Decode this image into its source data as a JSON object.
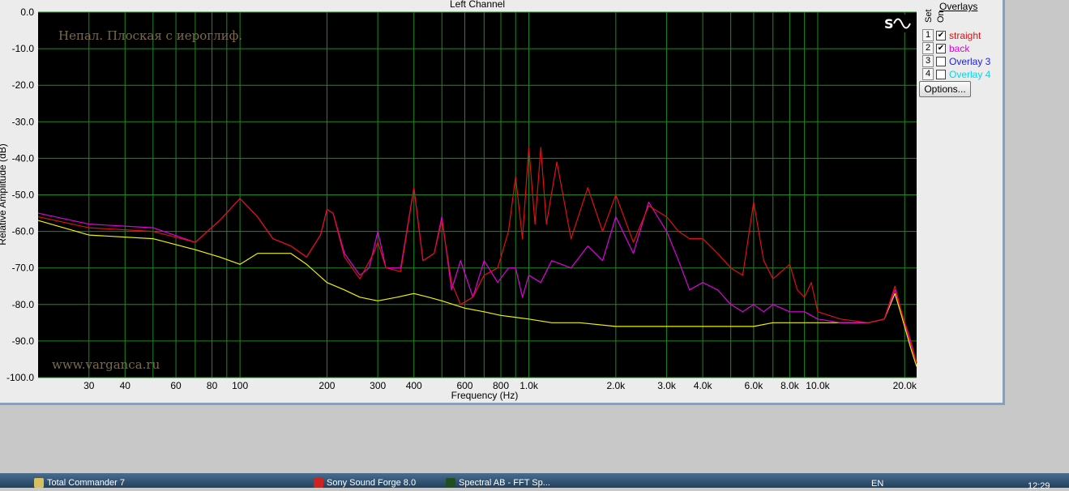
{
  "window": {
    "title": "Left Channel"
  },
  "overlays": {
    "title": "Overlays",
    "col_set": "Set",
    "col_on": "On",
    "items": [
      {
        "num": "1",
        "label": "straight",
        "checked": true,
        "color": "#e01010"
      },
      {
        "num": "2",
        "label": "back",
        "checked": true,
        "color": "#e000e0"
      },
      {
        "num": "3",
        "label": "Overlay 3",
        "checked": false,
        "color": "#2020e0"
      },
      {
        "num": "4",
        "label": "Overlay 4",
        "checked": false,
        "color": "#00d8e8"
      }
    ],
    "options_label": "Options..."
  },
  "icon": "sweep-sine-icon",
  "taskbar": {
    "items": [
      "Total Commander 7",
      "Sony Sound Forge 8.0",
      "Spectral AB - FFT Sp..."
    ],
    "lang": "EN",
    "clock": "12:29"
  },
  "chart_data": {
    "type": "line",
    "title": "Left Channel",
    "xlabel": "Frequency (Hz)",
    "ylabel": "Relative Amplitude (dB)",
    "x_scale": "log",
    "xlim": [
      20,
      22000
    ],
    "ylim": [
      -100,
      0
    ],
    "grid": true,
    "legend": "right",
    "annotations": [
      "Непал. Плоская с иероглиф.",
      "www.varganca.ru"
    ],
    "xticks": [
      {
        "v": 30,
        "l": "30"
      },
      {
        "v": 40,
        "l": "40"
      },
      {
        "v": 60,
        "l": "60"
      },
      {
        "v": 80,
        "l": "80"
      },
      {
        "v": 100,
        "l": "100"
      },
      {
        "v": 200,
        "l": "200"
      },
      {
        "v": 300,
        "l": "300"
      },
      {
        "v": 400,
        "l": "400"
      },
      {
        "v": 600,
        "l": "600"
      },
      {
        "v": 800,
        "l": "800"
      },
      {
        "v": 1000,
        "l": "1.0k"
      },
      {
        "v": 2000,
        "l": "2.0k"
      },
      {
        "v": 3000,
        "l": "3.0k"
      },
      {
        "v": 4000,
        "l": "4.0k"
      },
      {
        "v": 6000,
        "l": "6.0k"
      },
      {
        "v": 8000,
        "l": "8.0k"
      },
      {
        "v": 10000,
        "l": "10.0k"
      },
      {
        "v": 20000,
        "l": "20.0k"
      }
    ],
    "minor_x": [
      50,
      70,
      90,
      500,
      700,
      900,
      5000,
      7000,
      9000
    ],
    "yticks": [
      {
        "v": 0,
        "l": "0.0"
      },
      {
        "v": -10,
        "l": "-10.0"
      },
      {
        "v": -20,
        "l": "-20.0"
      },
      {
        "v": -30,
        "l": "-30.0"
      },
      {
        "v": -40,
        "l": "-40.0"
      },
      {
        "v": -50,
        "l": "-50.0"
      },
      {
        "v": -60,
        "l": "-60.0"
      },
      {
        "v": -70,
        "l": "-70.0"
      },
      {
        "v": -80,
        "l": "-80.0"
      },
      {
        "v": -90,
        "l": "-90.0"
      },
      {
        "v": -100,
        "l": "-100.0"
      }
    ],
    "series": [
      {
        "name": "straight",
        "color": "#e01010",
        "points": [
          [
            20,
            -56
          ],
          [
            30,
            -59
          ],
          [
            50,
            -60
          ],
          [
            70,
            -63
          ],
          [
            85,
            -57
          ],
          [
            100,
            -51
          ],
          [
            115,
            -56
          ],
          [
            130,
            -62
          ],
          [
            150,
            -64
          ],
          [
            170,
            -67
          ],
          [
            190,
            -61
          ],
          [
            200,
            -54
          ],
          [
            210,
            -55
          ],
          [
            230,
            -67
          ],
          [
            260,
            -73
          ],
          [
            290,
            -66
          ],
          [
            300,
            -63
          ],
          [
            320,
            -70
          ],
          [
            360,
            -71
          ],
          [
            400,
            -48
          ],
          [
            430,
            -68
          ],
          [
            470,
            -66
          ],
          [
            500,
            -57
          ],
          [
            540,
            -74
          ],
          [
            580,
            -80
          ],
          [
            640,
            -78
          ],
          [
            700,
            -72
          ],
          [
            780,
            -70
          ],
          [
            850,
            -60
          ],
          [
            900,
            -45
          ],
          [
            950,
            -62
          ],
          [
            1000,
            -37
          ],
          [
            1050,
            -58
          ],
          [
            1100,
            -37
          ],
          [
            1150,
            -58
          ],
          [
            1250,
            -41
          ],
          [
            1400,
            -62
          ],
          [
            1600,
            -48
          ],
          [
            1800,
            -60
          ],
          [
            2000,
            -50
          ],
          [
            2300,
            -63
          ],
          [
            2600,
            -53
          ],
          [
            3000,
            -56
          ],
          [
            3300,
            -60
          ],
          [
            3600,
            -62
          ],
          [
            4000,
            -62
          ],
          [
            4500,
            -66
          ],
          [
            5000,
            -70
          ],
          [
            5500,
            -72
          ],
          [
            6000,
            -52
          ],
          [
            6500,
            -68
          ],
          [
            7000,
            -73
          ],
          [
            8000,
            -69
          ],
          [
            8500,
            -76
          ],
          [
            9000,
            -78
          ],
          [
            9500,
            -74
          ],
          [
            10000,
            -82
          ],
          [
            12000,
            -84
          ],
          [
            15000,
            -85
          ],
          [
            17000,
            -84
          ],
          [
            18500,
            -75
          ],
          [
            19500,
            -82
          ],
          [
            21000,
            -90
          ],
          [
            22000,
            -96
          ]
        ]
      },
      {
        "name": "back",
        "color": "#e000e0",
        "points": [
          [
            20,
            -55
          ],
          [
            30,
            -58
          ],
          [
            50,
            -59
          ],
          [
            70,
            -63
          ],
          [
            85,
            -57
          ],
          [
            100,
            -51
          ],
          [
            115,
            -56
          ],
          [
            130,
            -62
          ],
          [
            150,
            -64
          ],
          [
            170,
            -67
          ],
          [
            190,
            -61
          ],
          [
            200,
            -54
          ],
          [
            210,
            -55
          ],
          [
            230,
            -66
          ],
          [
            260,
            -72
          ],
          [
            280,
            -70
          ],
          [
            300,
            -60
          ],
          [
            320,
            -70
          ],
          [
            360,
            -70
          ],
          [
            400,
            -48
          ],
          [
            430,
            -68
          ],
          [
            470,
            -66
          ],
          [
            500,
            -56
          ],
          [
            540,
            -76
          ],
          [
            580,
            -68
          ],
          [
            640,
            -78
          ],
          [
            700,
            -68
          ],
          [
            780,
            -74
          ],
          [
            850,
            -70
          ],
          [
            900,
            -70
          ],
          [
            950,
            -78
          ],
          [
            1000,
            -72
          ],
          [
            1100,
            -74
          ],
          [
            1200,
            -68
          ],
          [
            1400,
            -70
          ],
          [
            1600,
            -64
          ],
          [
            1800,
            -68
          ],
          [
            2000,
            -56
          ],
          [
            2300,
            -66
          ],
          [
            2600,
            -52
          ],
          [
            3000,
            -60
          ],
          [
            3300,
            -68
          ],
          [
            3600,
            -76
          ],
          [
            4000,
            -74
          ],
          [
            4500,
            -76
          ],
          [
            5000,
            -80
          ],
          [
            5500,
            -82
          ],
          [
            6000,
            -80
          ],
          [
            6500,
            -82
          ],
          [
            7000,
            -80
          ],
          [
            8000,
            -82
          ],
          [
            9000,
            -82
          ],
          [
            10000,
            -84
          ],
          [
            12000,
            -85
          ],
          [
            15000,
            -85
          ],
          [
            17000,
            -84
          ],
          [
            18500,
            -76
          ],
          [
            19500,
            -82
          ],
          [
            21000,
            -91
          ],
          [
            22000,
            -96
          ]
        ]
      },
      {
        "name": "",
        "color": "#f0f000",
        "points": [
          [
            20,
            -57
          ],
          [
            30,
            -61
          ],
          [
            50,
            -62
          ],
          [
            70,
            -65
          ],
          [
            85,
            -67
          ],
          [
            100,
            -69
          ],
          [
            115,
            -66
          ],
          [
            150,
            -66
          ],
          [
            170,
            -69
          ],
          [
            200,
            -74
          ],
          [
            230,
            -76
          ],
          [
            260,
            -78
          ],
          [
            300,
            -79
          ],
          [
            350,
            -78
          ],
          [
            400,
            -77
          ],
          [
            450,
            -78
          ],
          [
            500,
            -79
          ],
          [
            600,
            -81
          ],
          [
            700,
            -82
          ],
          [
            800,
            -83
          ],
          [
            1000,
            -84
          ],
          [
            1200,
            -85
          ],
          [
            1500,
            -85
          ],
          [
            2000,
            -86
          ],
          [
            3000,
            -86
          ],
          [
            4000,
            -86
          ],
          [
            5000,
            -86
          ],
          [
            6000,
            -86
          ],
          [
            7000,
            -85
          ],
          [
            8000,
            -85
          ],
          [
            10000,
            -85
          ],
          [
            12000,
            -85
          ],
          [
            15000,
            -85
          ],
          [
            17000,
            -84
          ],
          [
            18500,
            -77
          ],
          [
            19500,
            -83
          ],
          [
            21000,
            -92
          ],
          [
            22000,
            -97
          ]
        ]
      }
    ]
  }
}
